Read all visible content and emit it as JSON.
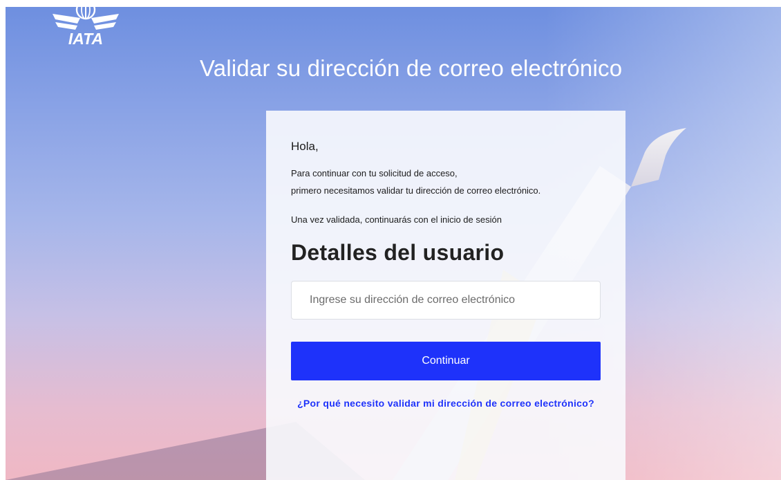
{
  "brand": {
    "logo_text": "IATA"
  },
  "page": {
    "title": "Validar su dirección de correo electrónico"
  },
  "card": {
    "greeting": "Hola,",
    "intro_line1": "Para continuar con tu solicitud de acceso,",
    "intro_line2": "primero necesitamos validar tu dirección de correo electrónico.",
    "intro_line3": "Una vez validada, continuarás con el inicio de sesión",
    "section_title": "Detalles del usuario",
    "email_placeholder": "Ingrese su dirección de correo electrónico",
    "email_value": "",
    "continue_label": "Continuar",
    "why_link": "¿Por qué necesito validar mi dirección de correo electrónico?"
  },
  "colors": {
    "primary": "#1e32fa",
    "title_text": "#ffffff",
    "card_bg": "#f8f9fd"
  }
}
